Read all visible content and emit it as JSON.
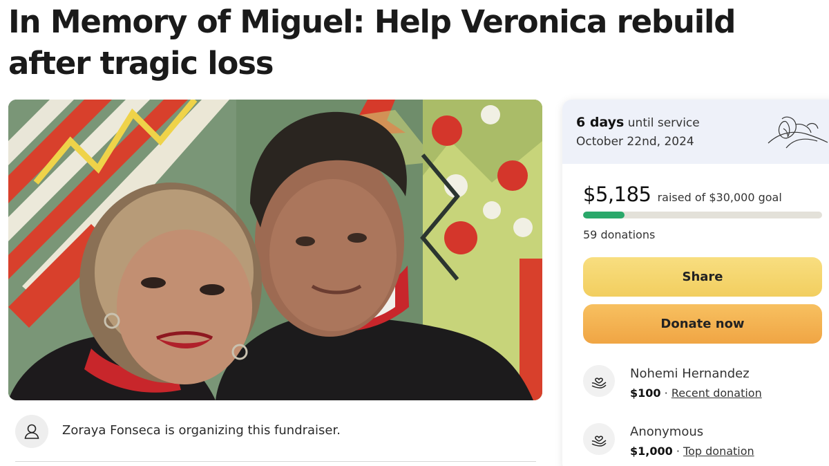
{
  "page": {
    "title": "In Memory of Miguel: Help Veronica rebuild after tragic loss"
  },
  "hero": {
    "icon": "fundraiser-photo"
  },
  "organizer": {
    "text": "Zoraya Fonseca is organizing this fundraiser.",
    "icon": "person-icon"
  },
  "service": {
    "days": "6 days",
    "until": "until service",
    "date": "October 22nd, 2024",
    "icon": "lily-flower-icon"
  },
  "progress": {
    "raised": "$5,185",
    "goal_text": "raised of $30,000 goal",
    "fraction": 0.1728,
    "donations": "59 donations",
    "bar_color": "#2aa86a"
  },
  "buttons": {
    "share": "Share",
    "donate": "Donate now"
  },
  "donations": [
    {
      "name": "Nohemi Hernandez",
      "amount": "$100",
      "separator": "·",
      "label": "Recent donation",
      "icon": "donation-hands-icon"
    },
    {
      "name": "Anonymous",
      "amount": "$1,000",
      "separator": "·",
      "label": "Top donation",
      "icon": "donation-hands-icon"
    }
  ],
  "colors": {
    "share_button": "#f2ce5f",
    "donate_button": "#f0a544",
    "card_header": "#eef1f9"
  }
}
